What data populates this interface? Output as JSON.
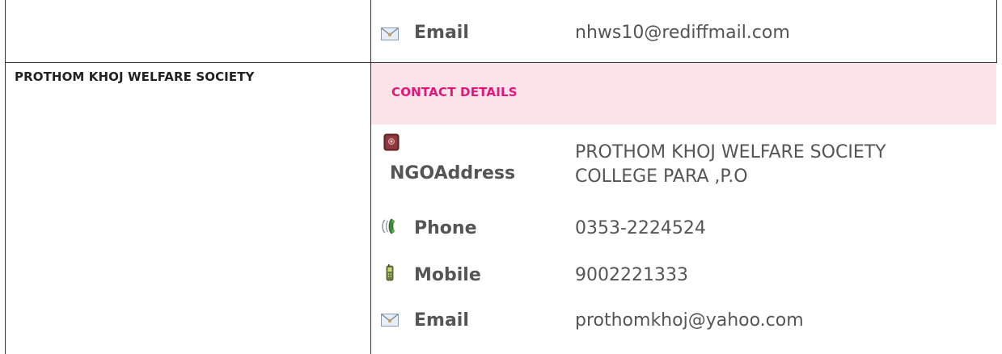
{
  "previous_entry": {
    "email": {
      "icon": "envelope-icon",
      "label": "Email",
      "value": "nhws10@rediffmail.com"
    }
  },
  "organization": {
    "name": "PROTHOM KHOJ WELFARE SOCIETY"
  },
  "contact_section": {
    "heading": "CONTACT DETAILS",
    "heading_color": "#e6147a",
    "band_color": "#fce4e8",
    "address": {
      "icon": "address-book-icon",
      "label": "NGOAddress",
      "line1": "PROTHOM KHOJ WELFARE SOCIETY",
      "line2": "COLLEGE PARA ,P.O"
    },
    "phone": {
      "icon": "phone-icon",
      "label": "Phone",
      "value": "0353-2224524"
    },
    "mobile": {
      "icon": "mobile-phone-icon",
      "label": "Mobile",
      "value": "9002221333"
    },
    "email": {
      "icon": "envelope-icon",
      "label": "Email",
      "value": "prothomkhoj@yahoo.com"
    }
  }
}
